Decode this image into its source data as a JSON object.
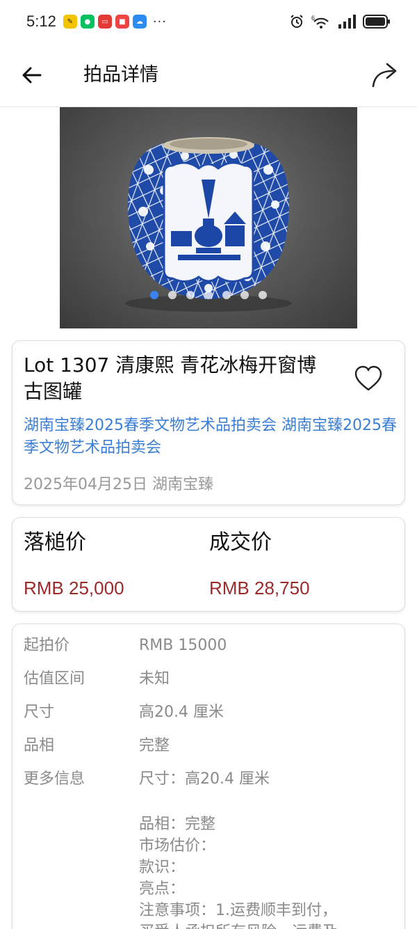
{
  "status_bar": {
    "time": "5:12",
    "more": "···",
    "signal_type": "6"
  },
  "header": {
    "title": "拍品详情"
  },
  "gallery": {
    "dot_count": 7,
    "active_index": 0
  },
  "lot": {
    "title": "Lot 1307 清康熙 青花冰梅开窗博古图罐",
    "auction": "湖南宝臻2025春季文物艺术品拍卖会 湖南宝臻2025春季文物艺术品拍卖会",
    "meta": "2025年04月25日 湖南宝臻"
  },
  "prices": {
    "hammer_label": "落槌价",
    "hammer_value": "RMB 25,000",
    "deal_label": "成交价",
    "deal_value": "RMB 28,750"
  },
  "info": {
    "start_label": "起拍价",
    "start_value": "RMB 15000",
    "estimate_label": "估值区间",
    "estimate_value": "未知",
    "size_label": "尺寸",
    "size_value": "高20.4 厘米",
    "condition_label": "品相",
    "condition_value": "完整",
    "more_label": "更多信息",
    "more_line1": "尺寸：高20.4 厘米",
    "more_line2": "品相：完整",
    "more_line3": "市场估价：",
    "more_line4": "款识：",
    "more_line5": "亮点：",
    "more_line6": "注意事项：1.运费顺丰到付，",
    "more_line7": "买受人承担所有风险，运费及"
  },
  "colors": {
    "link": "#3b7fd4",
    "price": "#9b2b2b",
    "active_dot": "#3b82f6"
  }
}
